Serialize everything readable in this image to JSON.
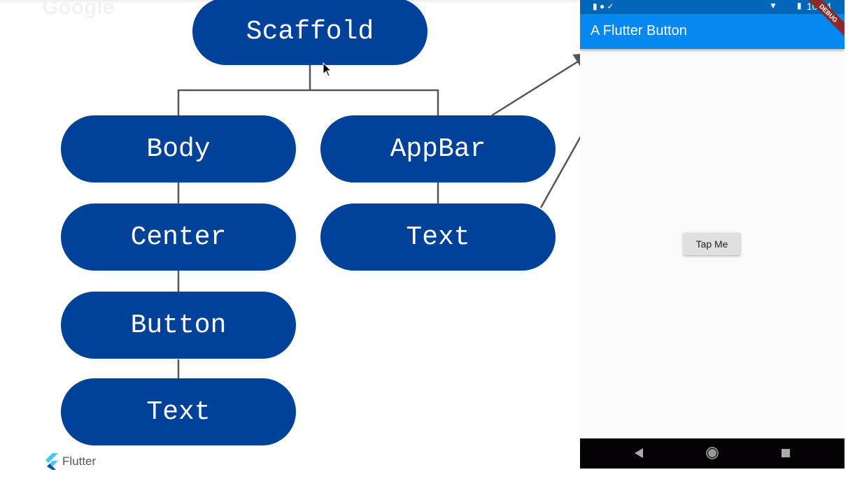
{
  "watermark": "Google",
  "diagram": {
    "nodes": {
      "scaffold": "Scaffold",
      "body": "Body",
      "appbar": "AppBar",
      "appbar_text": "Text",
      "center": "Center",
      "button": "Button",
      "body_text": "Text"
    },
    "node_color": "#00419a"
  },
  "phone": {
    "status_time": "10:54",
    "appbar_title": "A Flutter Button",
    "debug_banner": "DEBUG",
    "button_label": "Tap Me",
    "appbar_color": "#0588f0"
  },
  "footer": {
    "logo_text": "Flutter"
  }
}
